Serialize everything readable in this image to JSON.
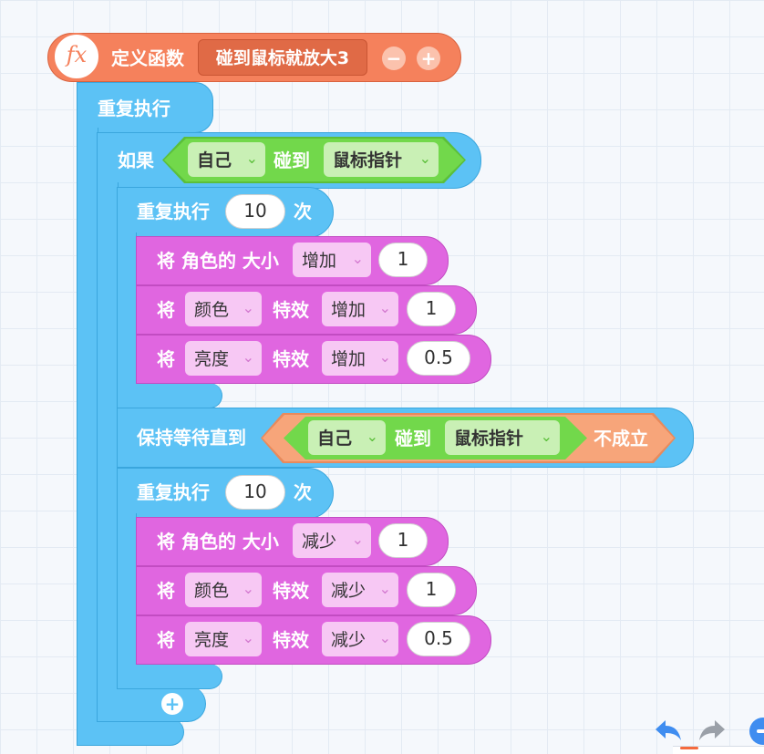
{
  "hat": {
    "fx_label": "fx",
    "define_label": "定义函数",
    "function_name": "碰到鼠标就放大3",
    "minus": "−",
    "plus": "+"
  },
  "outer_repeat": {
    "label": "重复执行"
  },
  "if_block": {
    "label": "如果",
    "subject": "自己",
    "verb": "碰到",
    "target": "鼠标指针"
  },
  "repeat1": {
    "label": "重复执行",
    "count": "10",
    "suffix": "次"
  },
  "grow_size": {
    "prefix": "将 角色的 大小",
    "op": "增加",
    "value": "1"
  },
  "grow_color": {
    "prefix": "将",
    "effect": "颜色",
    "mid": "特效",
    "op": "增加",
    "value": "1"
  },
  "grow_bright": {
    "prefix": "将",
    "effect": "亮度",
    "mid": "特效",
    "op": "增加",
    "value": "0.5"
  },
  "wait_until": {
    "label": "保持等待直到",
    "subject": "自己",
    "verb": "碰到",
    "target": "鼠标指针",
    "negation": "不成立"
  },
  "repeat2": {
    "label": "重复执行",
    "count": "10",
    "suffix": "次"
  },
  "shrink_size": {
    "prefix": "将 角色的 大小",
    "op": "减少",
    "value": "1"
  },
  "shrink_color": {
    "prefix": "将",
    "effect": "颜色",
    "mid": "特效",
    "op": "减少",
    "value": "1"
  },
  "shrink_bright": {
    "prefix": "将",
    "effect": "亮度",
    "mid": "特效",
    "op": "减少",
    "value": "0.5"
  },
  "add_button": "+",
  "chevron": "⌄",
  "colors": {
    "function": "#f5815c",
    "control": "#5cc2f5",
    "sensing": "#6fcf4b",
    "operator": "#f7a57a",
    "looks": "#e066e0"
  }
}
